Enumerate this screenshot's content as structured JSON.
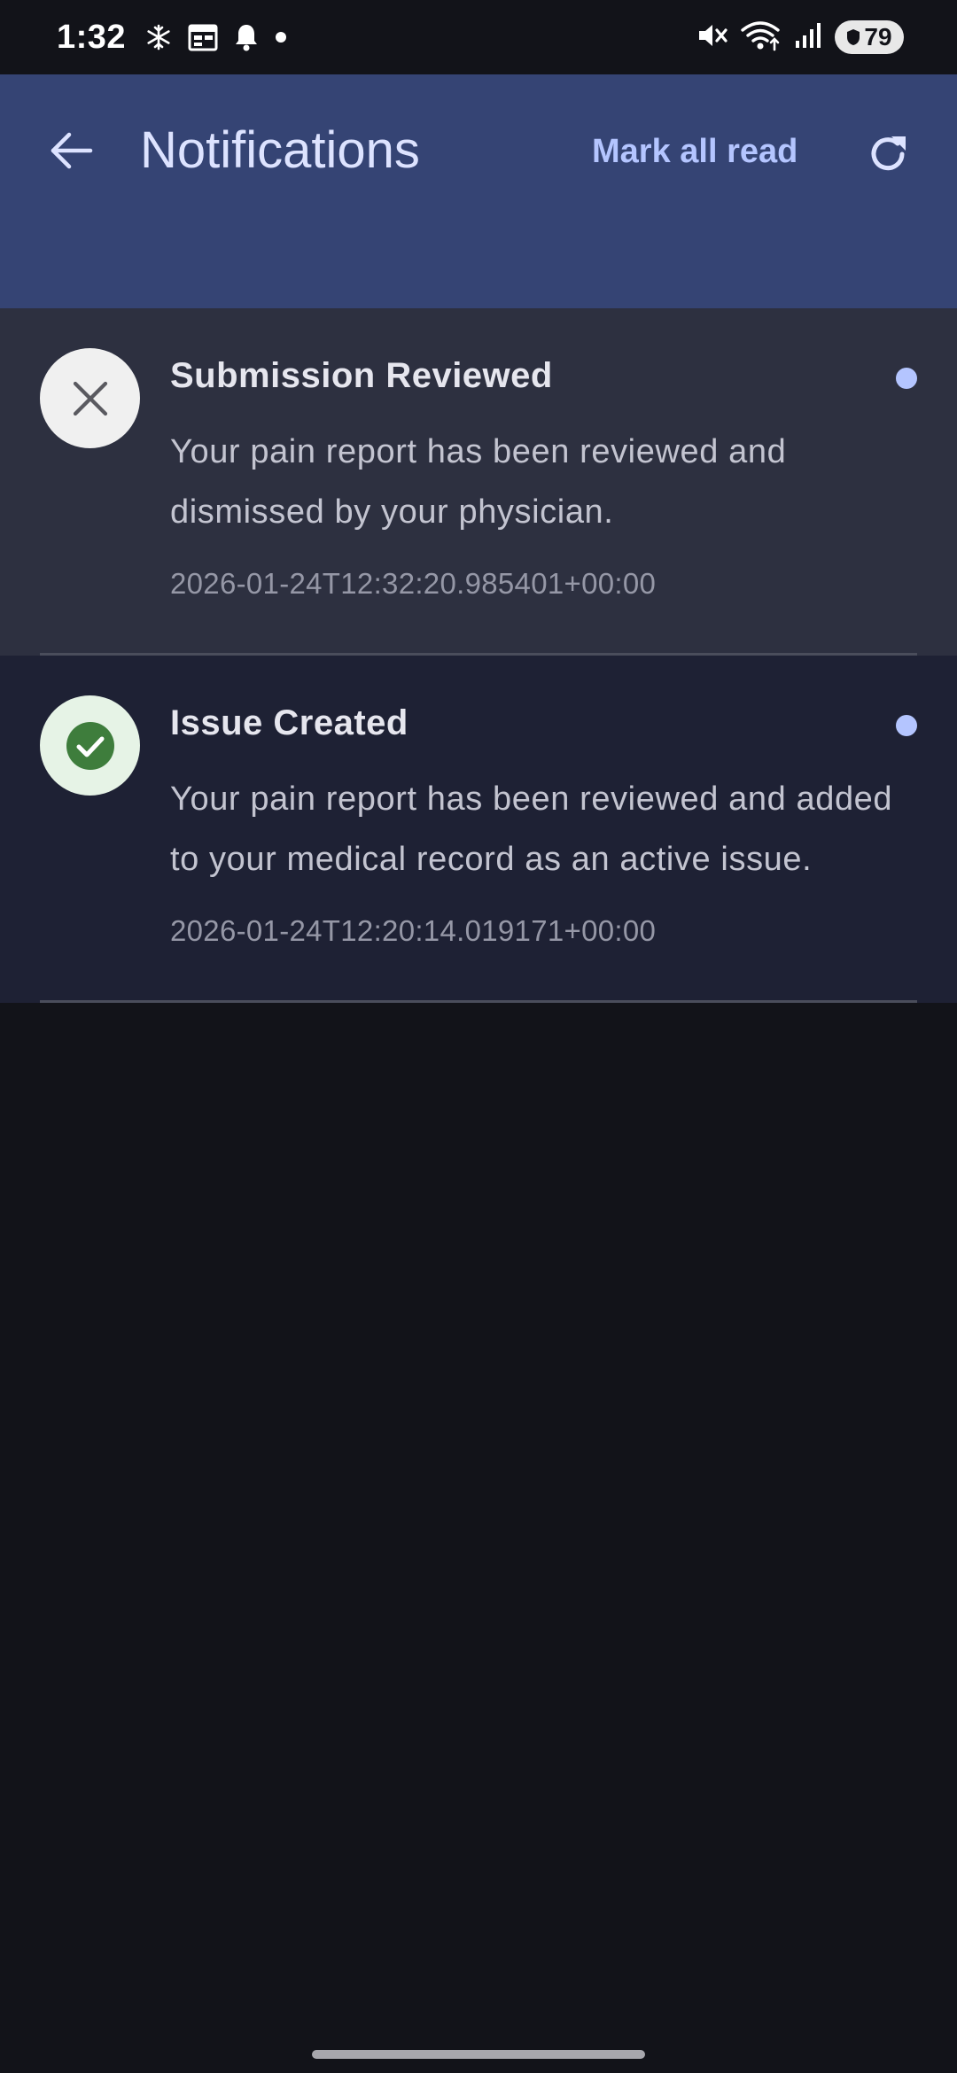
{
  "status_bar": {
    "time": "1:32",
    "battery": "79",
    "left_icons": [
      "snowflake-icon",
      "calendar-icon",
      "bell-icon",
      "dot-icon"
    ],
    "right_icons": [
      "mute-icon",
      "wifi-icon",
      "signal-icon",
      "battery-icon"
    ]
  },
  "app_bar": {
    "title": "Notifications",
    "mark_all_label": "Mark all read",
    "back_icon": "arrow-back-icon",
    "refresh_icon": "refresh-icon",
    "background": "#354474",
    "accent": "#b4c5ff"
  },
  "notifications": [
    {
      "title": "Submission Reviewed",
      "body": "Your pain report has been reviewed and dismissed by your physician.",
      "timestamp": "2026-01-24T12:32:20.985401+00:00",
      "icon": "close-icon",
      "unread": true
    },
    {
      "title": "Issue Created",
      "body": "Your pain report has been reviewed and added to your medical record as an active issue.",
      "timestamp": "2026-01-24T12:20:14.019171+00:00",
      "icon": "check-circle-icon",
      "unread": true
    }
  ]
}
